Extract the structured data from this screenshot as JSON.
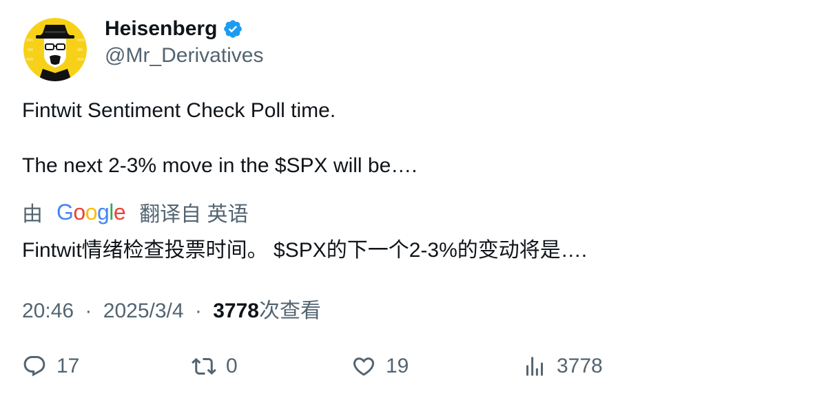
{
  "author": {
    "display_name": "Heisenberg",
    "handle": "@Mr_Derivatives",
    "verified": true,
    "verified_color": "#1d9bf0",
    "avatar_bg": "#f7d117"
  },
  "tweet": {
    "line1": "Fintwit Sentiment Check Poll time.",
    "line2": "The next 2-3% move in the $SPX will be…."
  },
  "translation": {
    "prefix": "由",
    "provider": "Google",
    "suffix": "翻译自 英语",
    "text": "Fintwit情绪检查投票时间。 $SPX的下一个2-3%的变动将是…."
  },
  "meta": {
    "time": "20:46",
    "separator": "·",
    "date": "2025/3/4",
    "views_count": "3778",
    "views_label": "次查看"
  },
  "actions": {
    "reply": {
      "icon": "reply-icon",
      "count": "17"
    },
    "retweet": {
      "icon": "retweet-icon",
      "count": "0"
    },
    "like": {
      "icon": "heart-icon",
      "count": "19"
    },
    "views": {
      "icon": "analytics-icon",
      "count": "3778"
    }
  },
  "colors": {
    "text_primary": "#0f1419",
    "text_secondary": "#536471",
    "google_blue": "#4285f4",
    "google_red": "#ea4335",
    "google_yellow": "#fbbc05",
    "google_green": "#34a853"
  }
}
